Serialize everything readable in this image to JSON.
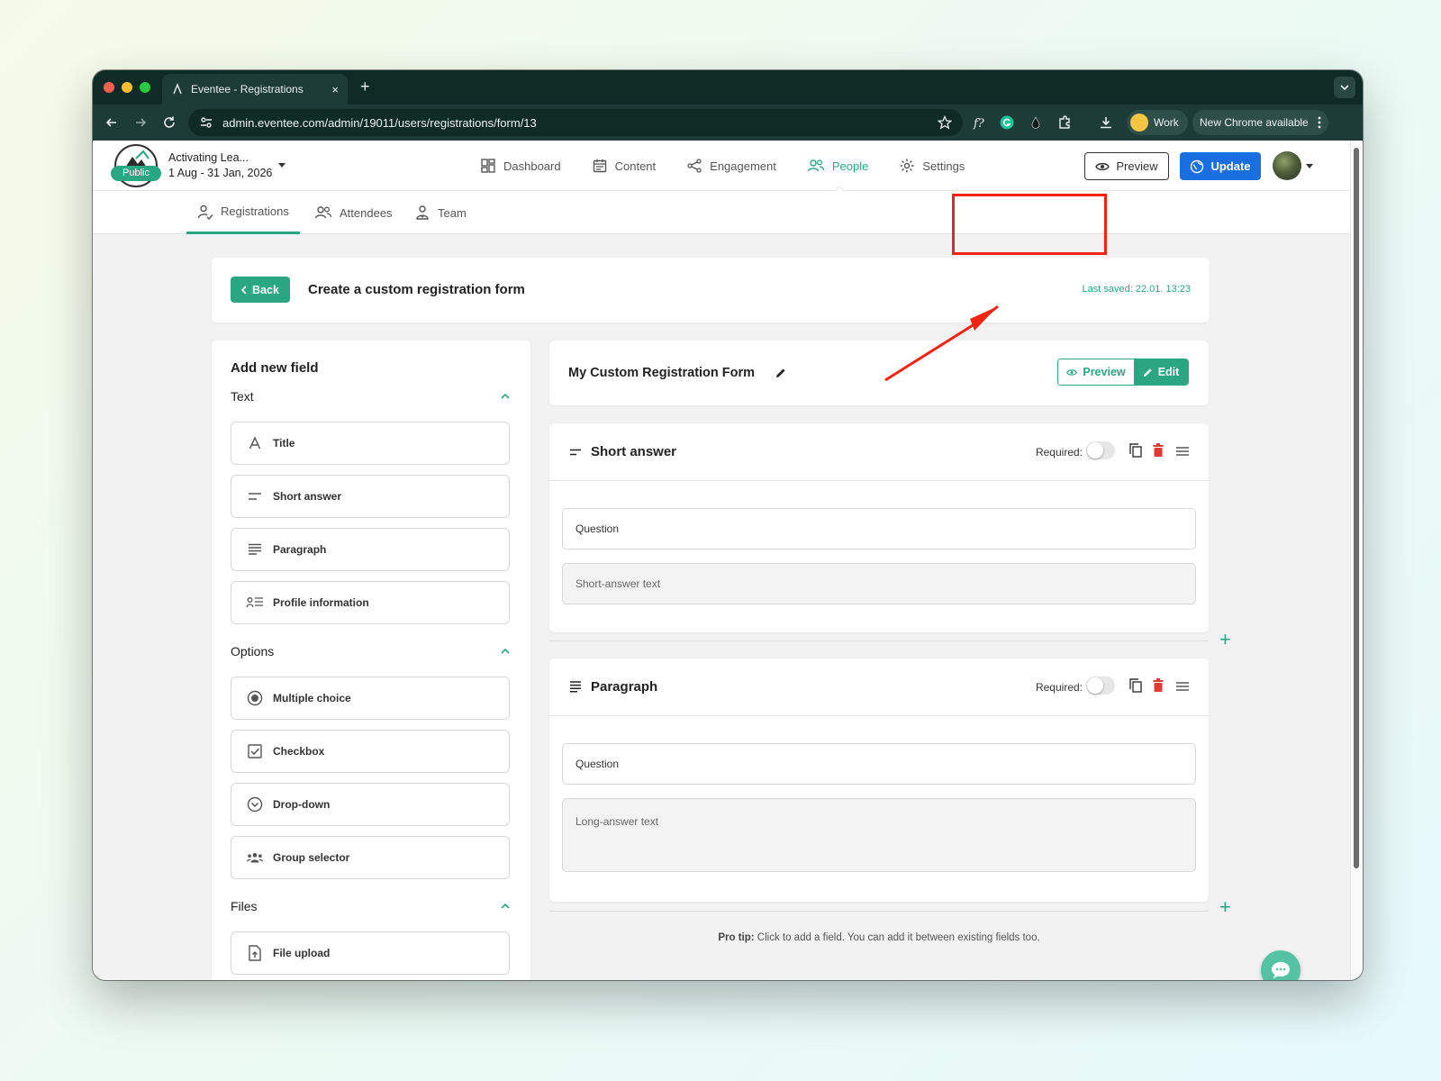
{
  "browser": {
    "tab_title": "Eventee - Registrations",
    "tab_close": "×",
    "new_tab": "+",
    "url": "admin.eventee.com/admin/19011/users/registrations/form/13",
    "profile": "Work",
    "update_notice": "New Chrome available"
  },
  "topnav": {
    "event_name": "Activating Lea...",
    "event_dates": "1 Aug - 31 Jan, 2026",
    "public_badge": "Public",
    "items": [
      {
        "label": "Dashboard"
      },
      {
        "label": "Content"
      },
      {
        "label": "Engagement"
      },
      {
        "label": "People"
      },
      {
        "label": "Settings"
      }
    ],
    "active_item": "People",
    "preview_label": "Preview",
    "update_label": "Update"
  },
  "subnav": {
    "tabs": [
      {
        "label": "Registrations"
      },
      {
        "label": "Attendees"
      },
      {
        "label": "Team"
      }
    ],
    "active_tab": "Registrations"
  },
  "header_card": {
    "back_label": "Back",
    "title": "Create a custom registration form",
    "last_saved": "Last saved: 22.01. 13:23"
  },
  "add_field_panel": {
    "title": "Add new field",
    "sections": [
      {
        "name": "Text",
        "items": [
          "Title",
          "Short answer",
          "Paragraph",
          "Profile information"
        ]
      },
      {
        "name": "Options",
        "items": [
          "Multiple choice",
          "Checkbox",
          "Drop-down",
          "Group selector"
        ]
      },
      {
        "name": "Files",
        "items": [
          "File upload"
        ]
      }
    ]
  },
  "form": {
    "title": "My Custom Registration Form",
    "mode_preview": "Preview",
    "mode_edit": "Edit",
    "active_mode": "Edit",
    "blocks": [
      {
        "title": "Short answer",
        "required_label": "Required:",
        "required": false,
        "question_label": "Question",
        "answer_placeholder": "Short-answer text"
      },
      {
        "title": "Paragraph",
        "required_label": "Required:",
        "required": false,
        "question_label": "Question",
        "answer_placeholder": "Long-answer text"
      }
    ],
    "add_symbol": "+",
    "pro_tip_label": "Pro tip:",
    "pro_tip_text": " Click to add a field. You can add it between existing fields too."
  },
  "colors": {
    "brand_green": "#2aa683",
    "update_blue": "#1a6fe0",
    "annotation_red": "#f02413",
    "delete_red": "#e53935"
  }
}
